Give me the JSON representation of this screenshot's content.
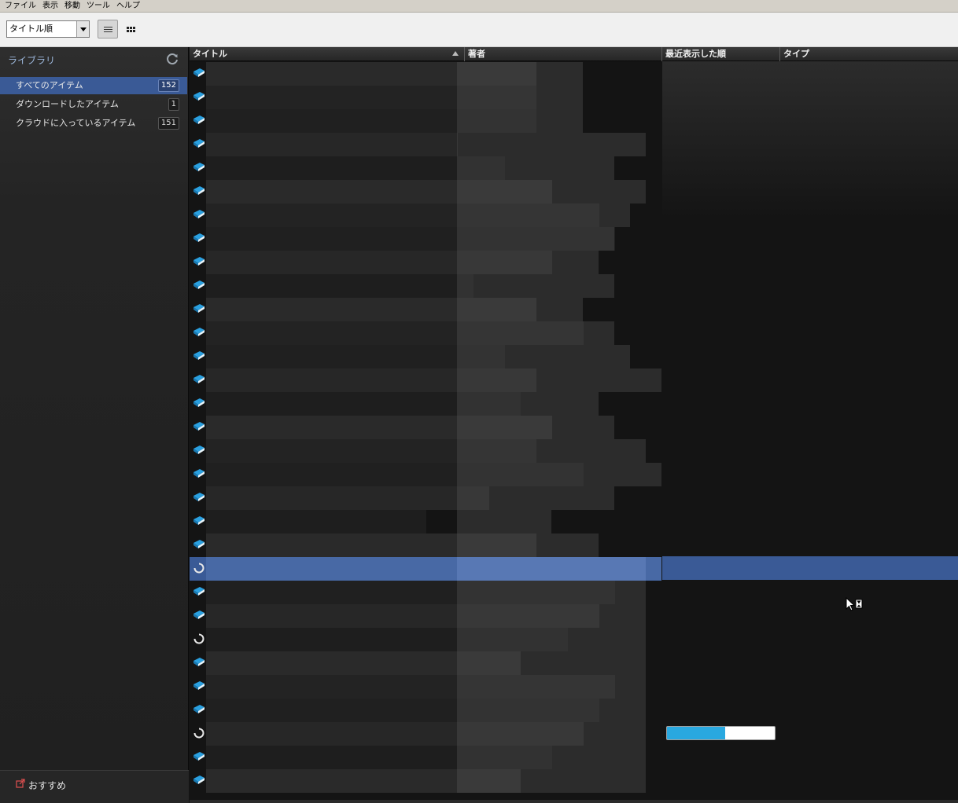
{
  "menu": [
    "ファイル",
    "表示",
    "移動",
    "ツール",
    "ヘルプ"
  ],
  "toolbar": {
    "sort_value": "タイトル順"
  },
  "sidebar": {
    "title": "ライブラリ",
    "items": [
      {
        "label": "すべてのアイテム",
        "count": "152",
        "selected": true
      },
      {
        "label": "ダウンロードしたアイテム",
        "count": "1",
        "selected": false
      },
      {
        "label": "クラウドに入っているアイテム",
        "count": "151",
        "selected": false
      }
    ],
    "recommend_label": "おすすめ"
  },
  "columns": [
    {
      "label": "タイトル",
      "sorted": "ascending"
    },
    {
      "label": "著者"
    },
    {
      "label": "最近表示した順"
    },
    {
      "label": "タイプ"
    }
  ],
  "rows": [
    {
      "icon": "book-icon"
    },
    {
      "icon": "book-icon"
    },
    {
      "icon": "book-icon"
    },
    {
      "icon": "book-icon"
    },
    {
      "icon": "book-icon"
    },
    {
      "icon": "book-icon"
    },
    {
      "icon": "book-icon"
    },
    {
      "icon": "book-icon"
    },
    {
      "icon": "book-icon"
    },
    {
      "icon": "book-icon"
    },
    {
      "icon": "book-icon"
    },
    {
      "icon": "book-icon"
    },
    {
      "icon": "book-icon"
    },
    {
      "icon": "book-icon"
    },
    {
      "icon": "book-icon"
    },
    {
      "icon": "book-icon"
    },
    {
      "icon": "book-icon"
    },
    {
      "icon": "book-icon"
    },
    {
      "icon": "book-icon"
    },
    {
      "icon": "book-icon"
    },
    {
      "icon": "book-icon"
    },
    {
      "icon": "loading-spinner-icon",
      "selected": true
    },
    {
      "icon": "book-icon"
    },
    {
      "icon": "book-icon"
    },
    {
      "icon": "loading-spinner-icon"
    },
    {
      "icon": "book-icon"
    },
    {
      "icon": "book-icon"
    },
    {
      "icon": "book-icon"
    },
    {
      "icon": "loading-spinner-icon",
      "progress": 0.54
    },
    {
      "icon": "book-icon"
    },
    {
      "icon": "book-icon"
    }
  ],
  "colors": {
    "selection": "#3a5a96",
    "progress": "#29a8e0",
    "accent": "#9ab4d8"
  }
}
